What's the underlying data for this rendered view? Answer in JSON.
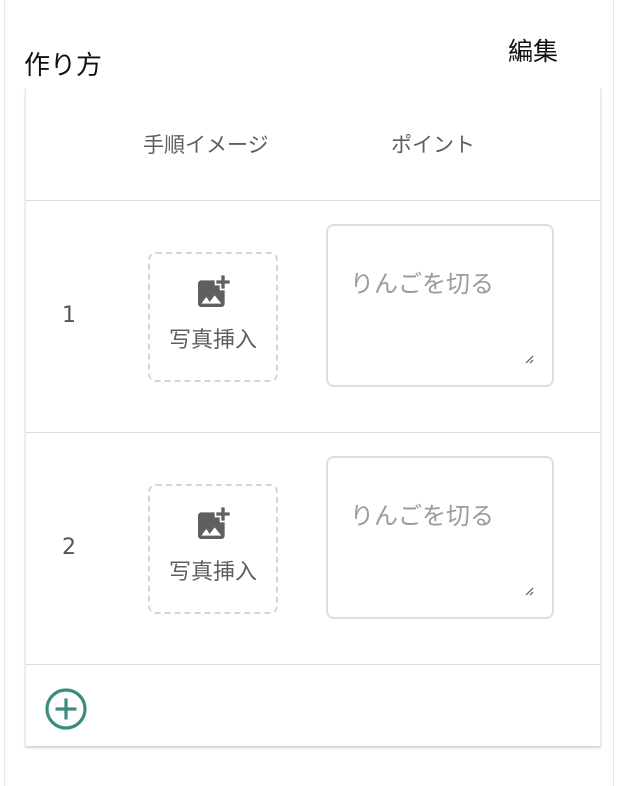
{
  "section": {
    "title": "作り方",
    "edit_label": "編集"
  },
  "table": {
    "headers": {
      "image": "手順イメージ",
      "point": "ポイント"
    },
    "steps": [
      {
        "number": "1",
        "photo_label": "写真挿入",
        "point_placeholder": "りんごを切る",
        "point_value": ""
      },
      {
        "number": "2",
        "photo_label": "写真挿入",
        "point_placeholder": "りんごを切る",
        "point_value": ""
      }
    ]
  },
  "icons": {
    "photo": "add-photo-icon",
    "add": "add-circle-icon"
  },
  "colors": {
    "accent": "#3d8c80",
    "icon_gray": "#5f5f5f",
    "border": "#dcdcdc"
  }
}
